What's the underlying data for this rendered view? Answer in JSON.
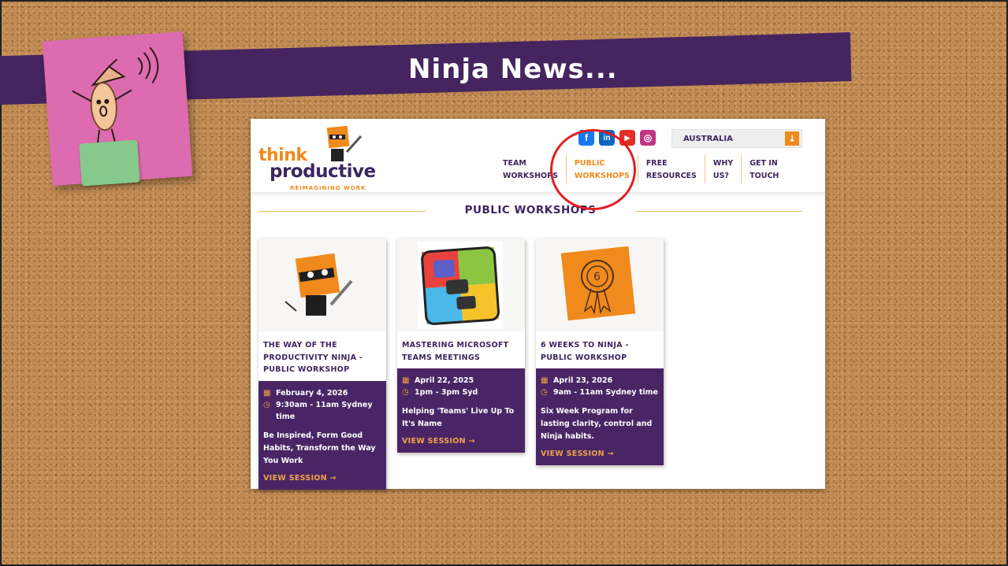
{
  "slide": {
    "title": "Ninja News..."
  },
  "site": {
    "logo": {
      "line1": "think",
      "line2": "productive",
      "tagline": "REIMAGINING WORK"
    },
    "social": [
      "f",
      "in",
      "▶",
      "◎"
    ],
    "country": "AUSTRALIA",
    "nav": [
      {
        "line1": "TEAM",
        "line2": "WORKSHOPS"
      },
      {
        "line1": "PUBLIC",
        "line2": "WORKSHOPS"
      },
      {
        "line1": "FREE",
        "line2": "RESOURCES"
      },
      {
        "line1": "WHY",
        "line2": "US?"
      },
      {
        "line1": "GET IN",
        "line2": "TOUCH"
      }
    ],
    "heading": "PUBLIC WORKSHOPS",
    "cards": [
      {
        "title": "THE WAY OF THE PRODUCTIVITY NINJA - PUBLIC WORKSHOP",
        "date": "February 4, 2026",
        "time": "9:30am - 11am Sydney time",
        "description": "Be Inspired, Form Good Habits, Transform the Way You Work",
        "cta": "VIEW SESSION →"
      },
      {
        "title": "MASTERING MICROSOFT TEAMS MEETINGS",
        "date": "April 22, 2025",
        "time": "1pm - 3pm Syd",
        "description": "Helping 'Teams' Live Up To It's Name",
        "cta": "VIEW SESSION →"
      },
      {
        "title": "6 WEEKS TO NINJA - PUBLIC WORKSHOP",
        "date": "April 23, 2026",
        "time": "9am - 11am Sydney time",
        "description": "Six Week Program for lasting clarity, control and Ninja habits.",
        "cta": "VIEW SESSION →"
      }
    ]
  },
  "colors": {
    "brand_purple": "#3d2560",
    "brand_orange": "#f08a1c",
    "highlight": "#e02020"
  }
}
